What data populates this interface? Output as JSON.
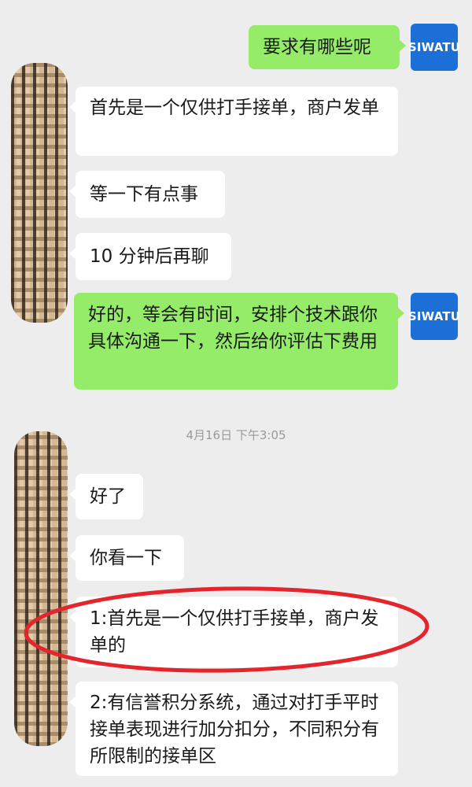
{
  "contact": {
    "self_avatar_text": "SIWATU"
  },
  "messages": {
    "m1": "要求有哪些呢",
    "m2": "首先是一个仅供打手接单，商户发单",
    "m3": "等一下有点事",
    "m4": "10 分钟后再聊",
    "m5": "好的，等会有时间，安排个技术跟你具体沟通一下，然后给你评估下费用",
    "timestamp": "4月16日 下午3:05",
    "m6": "好了",
    "m7": "你看一下",
    "m8": "1:首先是一个仅供打手接单，商户发单的",
    "m9": "2:有信誉积分系统，通过对打手平时接单表现进行加分扣分，不同积分有所限制的接单区"
  },
  "annotation": {
    "color": "#e3262d"
  }
}
